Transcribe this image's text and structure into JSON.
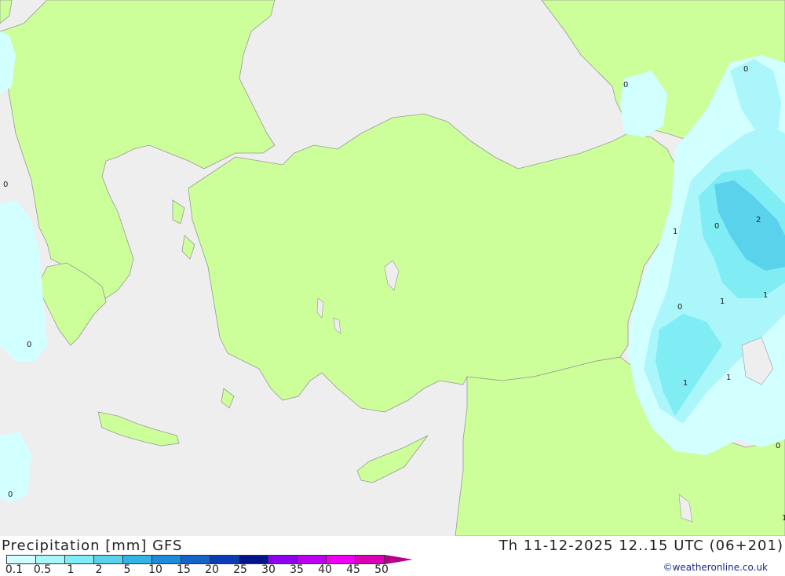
{
  "map": {
    "colors": {
      "sea": "#eeeeee",
      "land": "#ccff99",
      "border": "#999999",
      "precip_01": "#d2ffff",
      "precip_05": "#aaf6fa",
      "precip_1": "#80ecf4",
      "precip_2": "#5ad2ec"
    },
    "value_labels": [
      "0",
      "0",
      "0",
      "0",
      "0",
      "2",
      "1",
      "1",
      "1",
      "0",
      "1",
      "1",
      "1",
      "0",
      "0"
    ]
  },
  "footer": {
    "title_left": "Precipitation [mm] GFS",
    "title_right": "Th 11-12-2025 12..15 UTC (06+201)",
    "credit": "©weatheronline.co.uk"
  },
  "legend": {
    "labels": [
      "0.1",
      "0.5",
      "1",
      "2",
      "5",
      "10",
      "15",
      "20",
      "25",
      "30",
      "35",
      "40",
      "45",
      "50"
    ],
    "colors": [
      "#d2ffff",
      "#aaf6fa",
      "#80ecf4",
      "#5ad2ec",
      "#32b4e6",
      "#1e8cdc",
      "#1464c8",
      "#0a3cb4",
      "#00148c",
      "#8c00f0",
      "#be00f0",
      "#f000f0",
      "#dc00b4",
      "#b4008c"
    ]
  }
}
